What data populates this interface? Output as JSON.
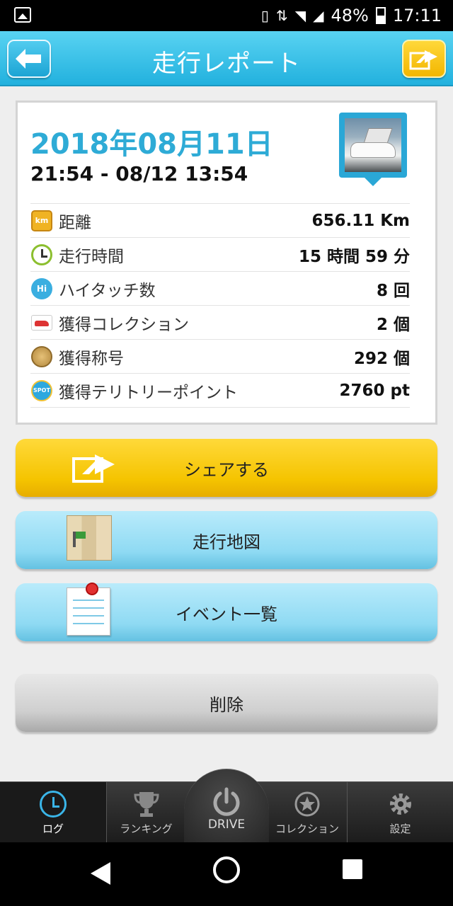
{
  "status_bar": {
    "battery": "48%",
    "time": "17:11",
    "icons": [
      "gallery-icon",
      "vibrate-icon",
      "data-icon",
      "wifi-icon",
      "signal-icon",
      "battery-icon"
    ]
  },
  "header": {
    "title": "走行レポート",
    "back_icon": "back-arrow-icon",
    "share_icon": "share-icon"
  },
  "report": {
    "date": "2018年08月11日",
    "time_range": "21:54 - 08/12 13:54",
    "photo_icon": "car-photo-icon",
    "stats": [
      {
        "icon": "km-icon",
        "label": "距離",
        "value": "656.11 Km"
      },
      {
        "icon": "clock-icon",
        "label": "走行時間",
        "value": "15 時間 59 分"
      },
      {
        "icon": "hi-touch-icon",
        "label": "ハイタッチ数",
        "value": "8 回"
      },
      {
        "icon": "car-collection-icon",
        "label": "獲得コレクション",
        "value": "2 個"
      },
      {
        "icon": "medal-icon",
        "label": "獲得称号",
        "value": "292 個"
      },
      {
        "icon": "spot-icon",
        "label": "獲得テリトリーポイント",
        "value": "2760 pt"
      }
    ]
  },
  "actions": {
    "share": "シェアする",
    "map": "走行地図",
    "events": "イベント一覧",
    "delete": "削除"
  },
  "tabs": {
    "log": "ログ",
    "ranking": "ランキング",
    "drive": "DRIVE",
    "collection": "コレクション",
    "settings": "設定"
  },
  "colors": {
    "header": "#2bb8e3",
    "date_text": "#2eabd6",
    "share_button": "#f5c400",
    "map_button": "#8fdaf3",
    "delete_button": "#cfcfcf",
    "tab_active": "#3ab5e8"
  }
}
